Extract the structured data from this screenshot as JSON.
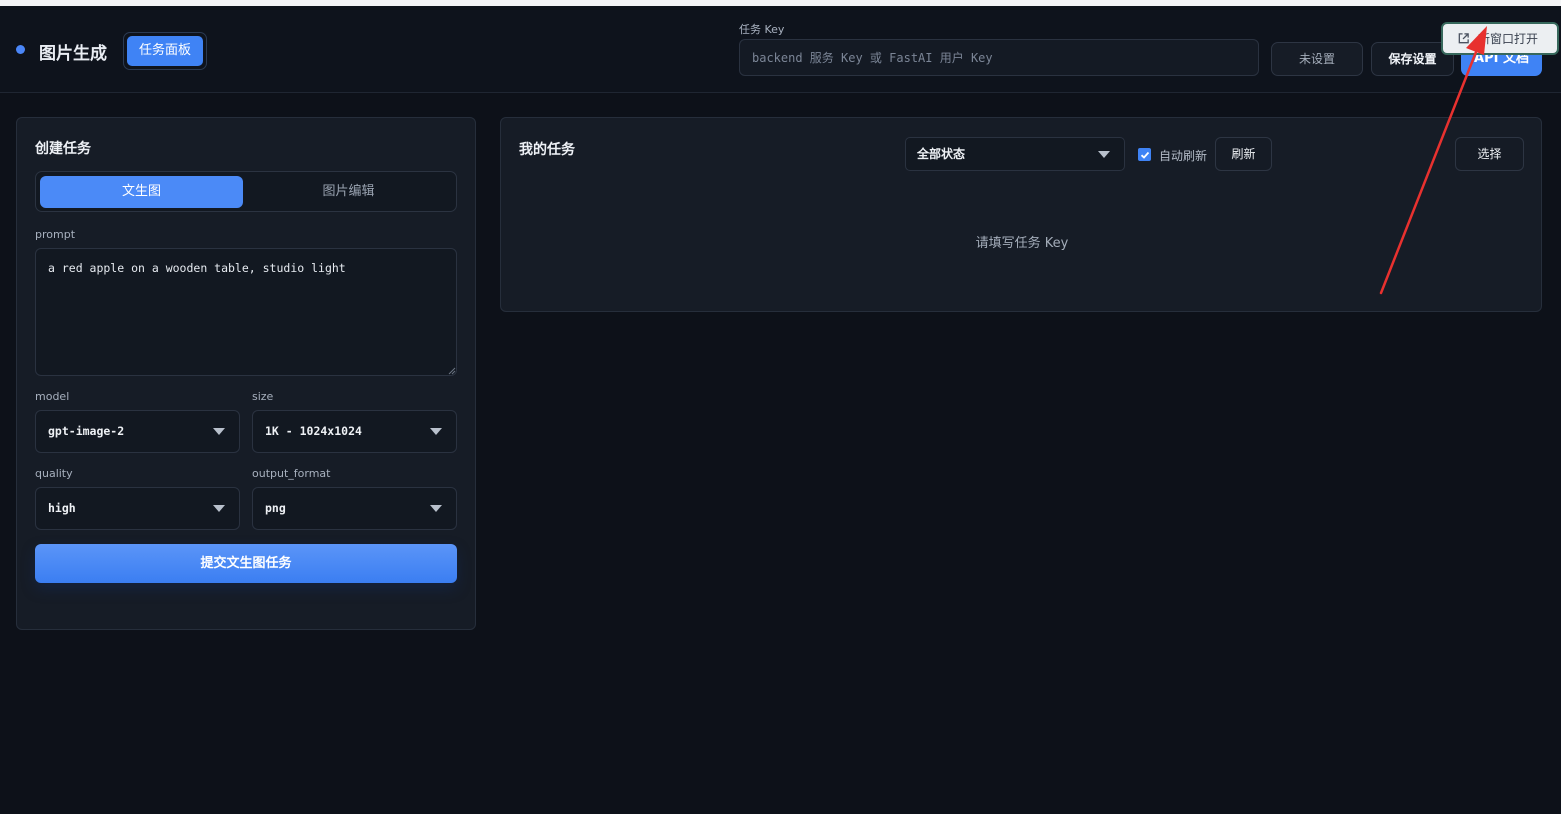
{
  "header": {
    "brand_title": "图片生成",
    "panel_button": "任务面板",
    "key_label": "任务 Key",
    "key_placeholder": "backend 服务 Key 或 FastAI 用户 Key",
    "unset_button": "未设置",
    "save_button": "保存设置",
    "api_button": "API 文档",
    "new_window_button": "新窗口打开"
  },
  "create": {
    "title": "创建任务",
    "tabs": [
      {
        "label": "文生图",
        "active": true
      },
      {
        "label": "图片编辑",
        "active": false
      }
    ],
    "prompt_label": "prompt",
    "prompt_value": "a red apple on a wooden table, studio light",
    "model_label": "model",
    "model_value": "gpt-image-2",
    "size_label": "size",
    "size_value": "1K - 1024x1024",
    "quality_label": "quality",
    "quality_value": "high",
    "format_label": "output_format",
    "format_value": "png",
    "submit_button": "提交文生图任务"
  },
  "tasks": {
    "title": "我的任务",
    "status_filter": "全部状态",
    "auto_refresh_label": "自动刷新",
    "auto_refresh_checked": true,
    "refresh_button": "刷新",
    "select_button": "选择",
    "empty_message": "请填写任务 Key"
  },
  "colors": {
    "accent": "#3f83f5",
    "background": "#0d1119",
    "card": "#161c26",
    "annotation": "#e8312f"
  }
}
